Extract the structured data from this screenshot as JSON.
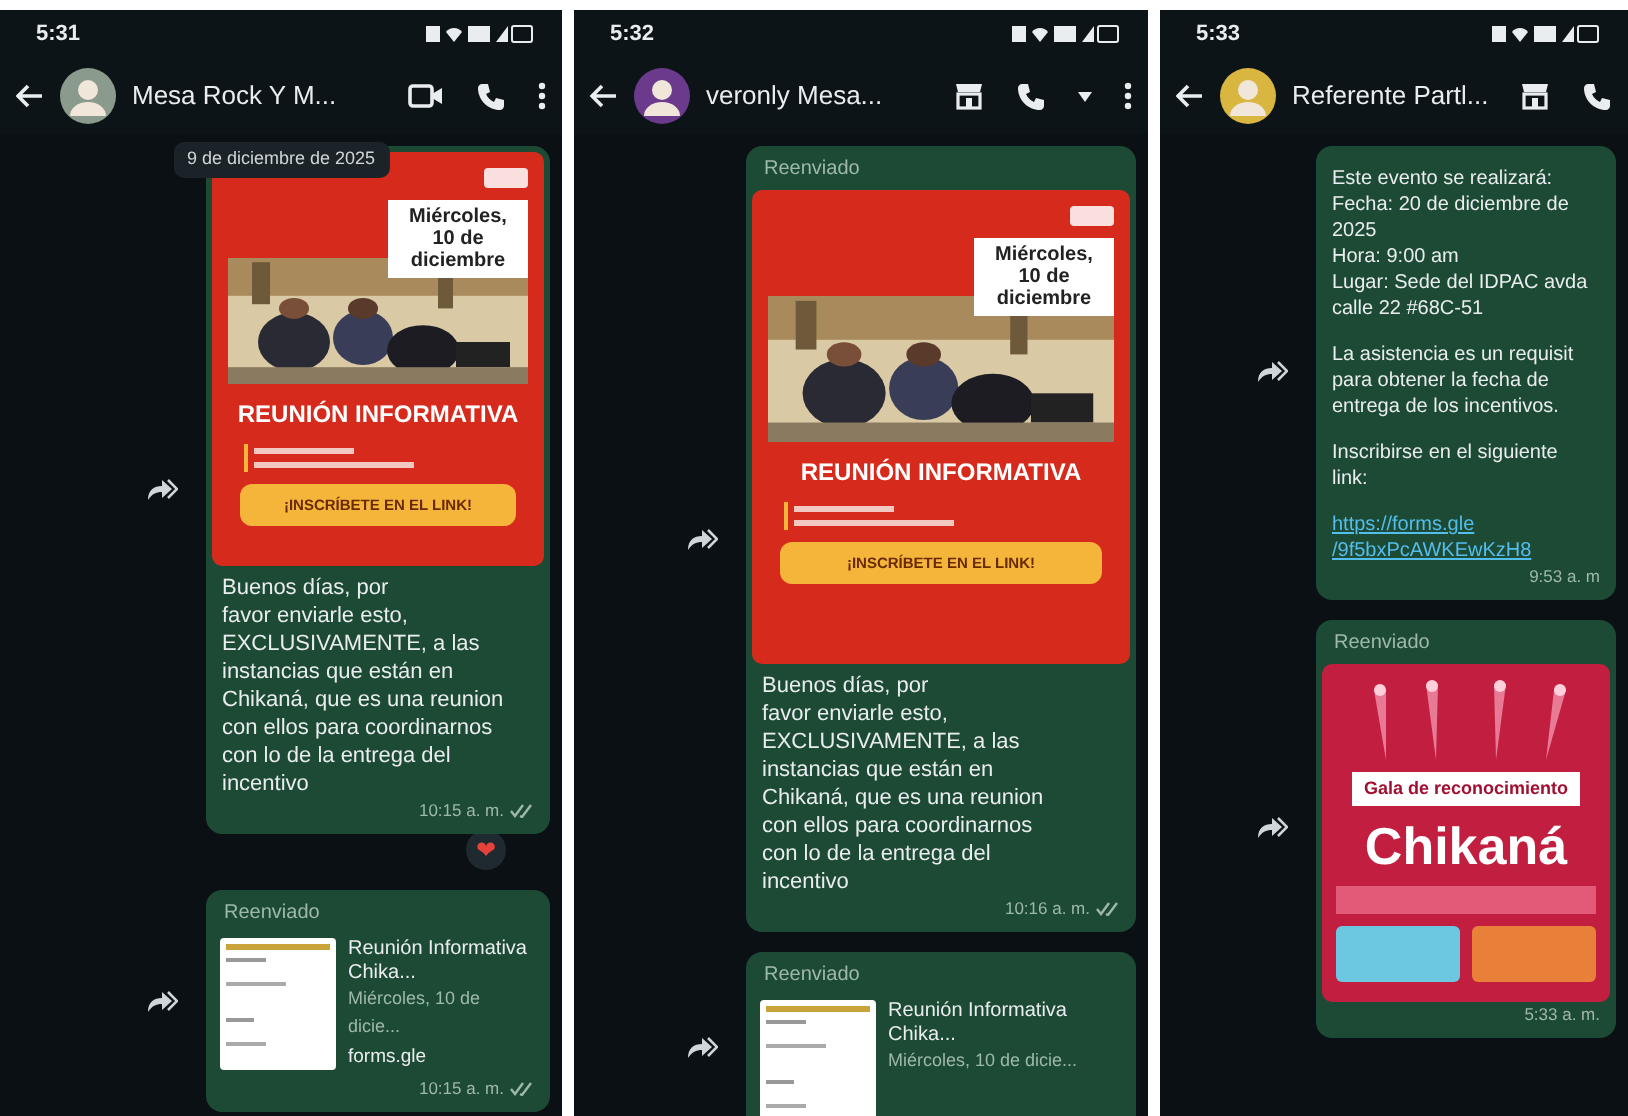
{
  "panels": [
    {
      "status_time": "5:31",
      "avatar": {
        "color": "#8a9a8c"
      },
      "contact": "Mesa Rock Y M...",
      "actions": [
        {
          "kind": "video"
        },
        {
          "kind": "call"
        },
        {
          "kind": "menu"
        }
      ],
      "date_chip": "9 de diciembre de 2025",
      "messages": [
        {
          "kind": "poster",
          "poster": {
            "kind": "meeting",
            "date": "Miércoles, 10 de diciembre",
            "title": "REUNIÓN INFORMATIVA",
            "cta": "¡INSCRÍBETE EN EL LINK!"
          },
          "lines": [
            "Buenos días, por",
            "favor enviarle esto,",
            "EXCLUSIVAMENTE, a las",
            "instancias que están en",
            "Chikaná, que es una reunion",
            "con ellos para coordinarnos",
            "con lo de la entrega del",
            "incentivo"
          ],
          "time": "10:15 a. m.",
          "ticks": true,
          "reaction": "❤"
        },
        {
          "kind": "link",
          "label": "Reenviado",
          "title": "Reunión Informativa Chika...",
          "subtitle": "Miércoles, 10 de dicie...",
          "domain": "forms.gle",
          "time": "10:15 a. m.",
          "ticks": true
        }
      ]
    },
    {
      "status_time": "5:32",
      "avatar": {
        "color": "#6b3a8c"
      },
      "contact": "veronly Mesa...",
      "actions": [
        {
          "kind": "store"
        },
        {
          "kind": "call"
        },
        {
          "kind": "caret"
        },
        {
          "kind": "menu"
        }
      ],
      "messages": [
        {
          "kind": "poster",
          "label": "Reenviado",
          "poster": {
            "kind": "meeting",
            "date": "Miércoles, 10 de diciembre",
            "title": "REUNIÓN INFORMATIVA",
            "cta": "¡INSCRÍBETE EN EL LINK!"
          },
          "lines": [
            "Buenos días, por",
            "favor enviarle esto,",
            "EXCLUSIVAMENTE, a las",
            "instancias que están en",
            "Chikaná, que es una reunion",
            "con ellos para coordinarnos",
            "con lo de la entrega del",
            "incentivo"
          ],
          "time": "10:16 a. m.",
          "ticks": true
        },
        {
          "kind": "link",
          "label": "Reenviado",
          "title": "Reunión Informativa Chika...",
          "subtitle": "Miércoles, 10 de dicie..."
        }
      ]
    },
    {
      "status_time": "5:33",
      "avatar": {
        "color": "#d8b640"
      },
      "contact": "Referente Partl...",
      "actions": [
        {
          "kind": "store"
        },
        {
          "kind": "call"
        }
      ],
      "messages": [
        {
          "kind": "text",
          "paragraphs": [
            [
              "Este evento se realizará:",
              "Fecha: 20 de diciembre de",
              "2025",
              "Hora: 9:00 am",
              "Lugar: Sede del IDPAC avda",
              "calle 22 #68C-51"
            ],
            [
              "La asistencia es un requisit",
              "para obtener la fecha de",
              "entrega de los incentivos."
            ],
            [
              "Inscribirse en el siguiente",
              "link:"
            ]
          ],
          "link": [
            "https://forms.gle",
            "/9f5bxPcAWKEwKzH8"
          ],
          "time": "9:53 a. m"
        },
        {
          "kind": "poster",
          "label": "Reenviado",
          "poster": {
            "kind": "gala",
            "banner": "Gala de reconocimiento",
            "title": "Chikaná"
          },
          "time": "5:33 a. m."
        }
      ]
    }
  ]
}
